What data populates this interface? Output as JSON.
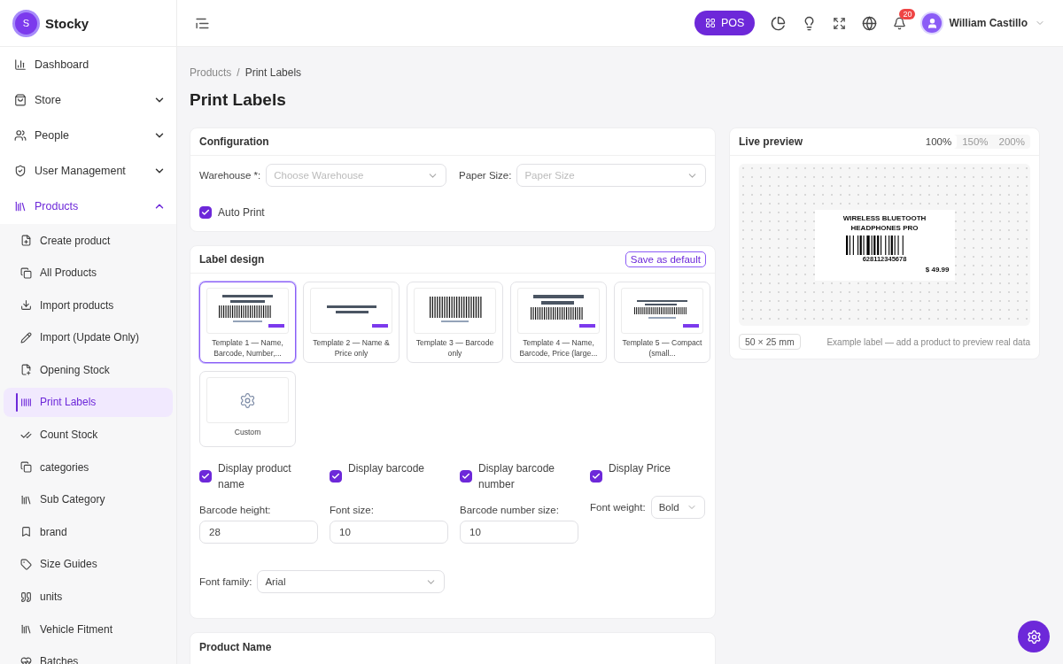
{
  "app": {
    "name": "Stocky",
    "logo_letter": "S"
  },
  "sidebar": {
    "items": [
      {
        "label": "Dashboard",
        "kind": "link",
        "selected": false
      },
      {
        "label": "Store",
        "kind": "group",
        "selected": false,
        "expanded": false
      },
      {
        "label": "People",
        "kind": "group",
        "selected": false,
        "expanded": false
      },
      {
        "label": "User Management",
        "kind": "group",
        "selected": false,
        "expanded": false
      },
      {
        "label": "Products",
        "kind": "group",
        "selected": true,
        "expanded": true,
        "children": [
          {
            "label": "Create product",
            "selected": false
          },
          {
            "label": "All Products",
            "selected": false
          },
          {
            "label": "Import products",
            "selected": false
          },
          {
            "label": "Import (Update Only)",
            "selected": false
          },
          {
            "label": "Opening Stock",
            "selected": false
          },
          {
            "label": "Print Labels",
            "selected": true
          },
          {
            "label": "Count Stock",
            "selected": false
          },
          {
            "label": "categories",
            "selected": false
          },
          {
            "label": "Sub Category",
            "selected": false
          },
          {
            "label": "brand",
            "selected": false
          },
          {
            "label": "Size Guides",
            "selected": false
          },
          {
            "label": "units",
            "selected": false
          },
          {
            "label": "Vehicle Fitment",
            "selected": false
          },
          {
            "label": "Batches",
            "selected": false
          }
        ]
      }
    ]
  },
  "topbar": {
    "pos_label": "POS",
    "notification_count": "20",
    "user_name": "William Castillo"
  },
  "breadcrumb": {
    "items": [
      "Products",
      "Print Labels"
    ],
    "separator": "/"
  },
  "page_title": "Print Labels",
  "configuration": {
    "title": "Configuration",
    "fields": [
      {
        "label": "Warehouse *:",
        "placeholder": "Choose Warehouse"
      },
      {
        "label": "Paper Size:",
        "placeholder": "Paper Size"
      }
    ],
    "auto_print": {
      "label": "Auto Print",
      "checked": true
    }
  },
  "label_design": {
    "title": "Label design",
    "save_label": "Save as default",
    "templates": [
      {
        "label": "Template 1 — Name, Barcode, Number,...",
        "kind": "full",
        "selected": true
      },
      {
        "label": "Template 2 — Name & Price only",
        "kind": "name-price",
        "selected": false
      },
      {
        "label": "Template 3 — Barcode only",
        "kind": "barcode",
        "selected": false
      },
      {
        "label": "Template 4 — Name, Barcode, Price (large...",
        "kind": "large",
        "selected": false
      },
      {
        "label": "Template 5 — Compact (small...",
        "kind": "compact",
        "selected": false
      },
      {
        "label": "Custom",
        "kind": "custom",
        "selected": false
      }
    ],
    "options": [
      {
        "label": "Display product name",
        "checked": true
      },
      {
        "label": "Display barcode",
        "checked": true
      },
      {
        "label": "Display barcode number",
        "checked": true
      },
      {
        "label": "Display Price",
        "checked": true
      }
    ],
    "number_fields": [
      {
        "label": "Barcode height:",
        "value": "28"
      },
      {
        "label": "Font size:",
        "value": "10"
      },
      {
        "label": "Barcode number size:",
        "value": "10"
      }
    ],
    "font_weight": {
      "label": "Font weight:",
      "value": "Bold"
    },
    "font_family": {
      "label": "Font family:",
      "value": "Arial"
    }
  },
  "product_card": {
    "title": "Product Name"
  },
  "preview": {
    "title": "Live preview",
    "zoom": [
      {
        "label": "100%",
        "selected": true
      },
      {
        "label": "150%",
        "selected": false
      },
      {
        "label": "200%",
        "selected": false
      }
    ],
    "label": {
      "name": "WIRELESS BLUETOOTH HEADPHONES PRO",
      "number": "628112345678",
      "price": "$ 49.99"
    },
    "size": "50 × 25 mm",
    "note": "Example label — add a product to preview real data"
  }
}
